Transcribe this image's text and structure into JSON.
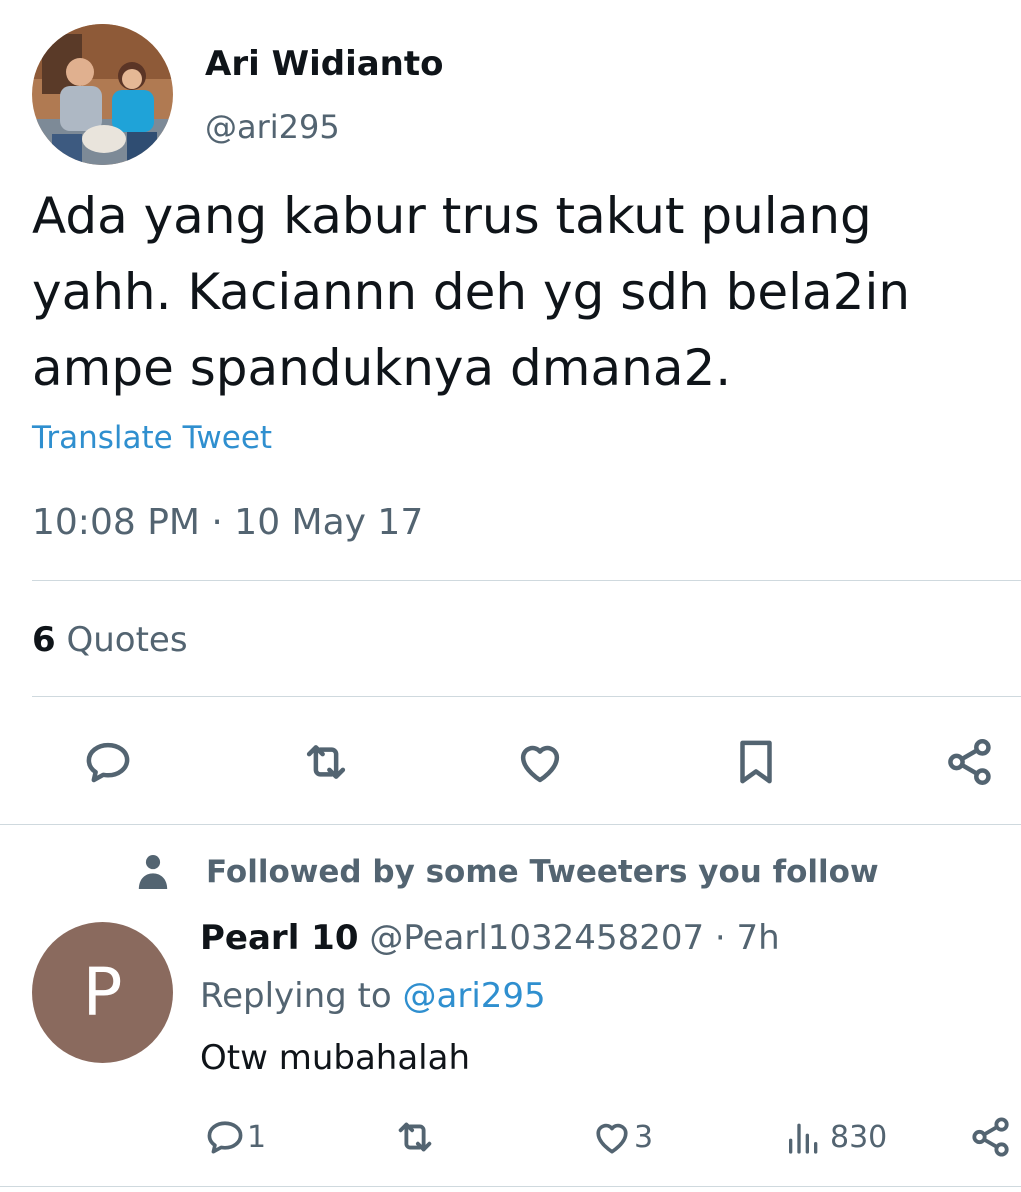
{
  "tweet": {
    "author_name": "Ari Widianto",
    "author_handle": "@ari295",
    "text": "Ada yang kabur trus takut pulang yahh. Kaciannn deh yg sdh bela2in ampe spanduknya dmana2.",
    "translate_label": "Translate Tweet",
    "timestamp": "10:08 PM · 10 May 17",
    "quotes_count": "6",
    "quotes_label": "Quotes"
  },
  "actions": {
    "icons": [
      "reply-icon",
      "retweet-icon",
      "like-icon",
      "bookmark-icon",
      "share-icon"
    ]
  },
  "social_context": {
    "label": "Followed by some Tweeters you follow",
    "icon": "person-icon"
  },
  "reply": {
    "avatar_letter": "P",
    "avatar_color": "#8a6a5e",
    "name": "Pearl 10",
    "handle_time": "@Pearl1032458207 · 7h",
    "replying_prefix": "Replying to",
    "replying_mention": "@ari295",
    "text": "Otw mubahalah",
    "reply_count": "1",
    "like_count": "3",
    "views_count": "830"
  },
  "colors": {
    "text": "#0f1419",
    "secondary": "#536471",
    "link": "#2f8fcf",
    "divider": "#cfd9de"
  }
}
